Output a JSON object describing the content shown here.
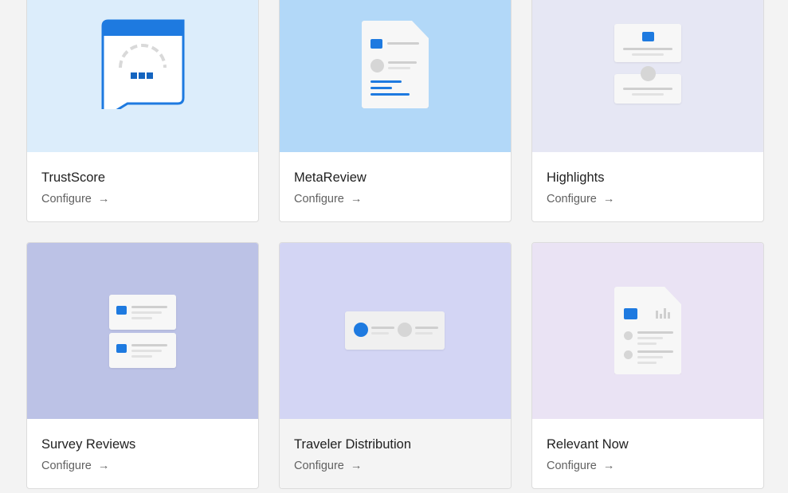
{
  "cards": [
    {
      "title": "TrustScore",
      "action": "Configure",
      "bg": "#dcedfb"
    },
    {
      "title": "MetaReview",
      "action": "Configure",
      "bg": "#b2d8f8"
    },
    {
      "title": "Highlights",
      "action": "Configure",
      "bg": "#e6e7f4"
    },
    {
      "title": "Survey Reviews",
      "action": "Configure",
      "bg": "#bcc2e6"
    },
    {
      "title": "Traveler Distribution",
      "action": "Configure",
      "bg": "#d3d5f4"
    },
    {
      "title": "Relevant Now",
      "action": "Configure",
      "bg": "#eae3f4"
    }
  ],
  "colors": {
    "accent": "#1e7ae0",
    "page_bg": "#f3f3f3"
  }
}
